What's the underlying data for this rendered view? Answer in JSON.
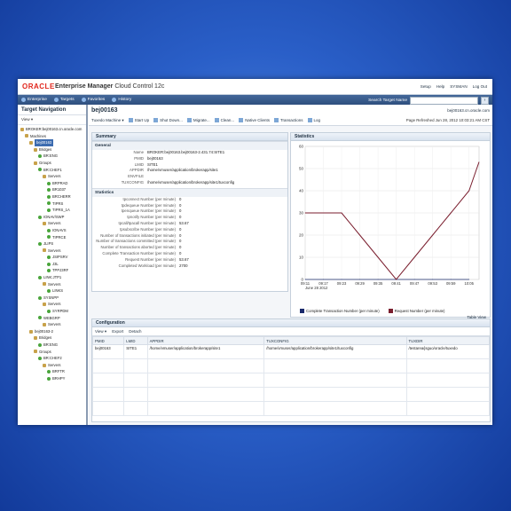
{
  "header": {
    "logo": "ORACLE",
    "product": "Enterprise Manager",
    "edition": "Cloud Control 12c",
    "links": [
      "Setup",
      "Help",
      "SYSMAN",
      "Log Out"
    ]
  },
  "menu": [
    "Enterprise",
    "Targets",
    "Favorites",
    "History"
  ],
  "search": {
    "label": "Search Target Name"
  },
  "nav": {
    "title": "Target Navigation",
    "view": "View ▾",
    "items": [
      "BROKER:bej00163.cn.oracle.com",
      "Machines",
      "bej00163",
      "Bridges",
      "BR:ENG",
      "Groups",
      "BR:CHEF1",
      "Servers",
      "BRPRAD",
      "BR1037",
      "BRCHERR",
      "TIPRS",
      "TIPRS_1A",
      "IONAV/SWP",
      "Servers",
      "IONAVS",
      "TIPRCE",
      "JLIPS",
      "Servers",
      "JSIPSRV",
      "J3L",
      "TPPJ3RF",
      "LINK:JTP1",
      "Servers",
      "LINKS",
      "SYSNPP",
      "Servers",
      "SYRPDM",
      "WEBGRP",
      "Servers",
      "bej00163-2",
      "Bridges",
      "BR:ENG",
      "Groups",
      "BR:CHEF2",
      "Servers",
      "BRFTR",
      "BRHPY"
    ]
  },
  "title": {
    "name": "bej00163",
    "domain": "bej00163.cn.oracle.com"
  },
  "actions": [
    "Tuxedo Machine ▾",
    "Start Up",
    "Shut Down...",
    "Migrate...",
    "Clean...",
    "Native Clients",
    "Transactions",
    "Log"
  ],
  "refresh": "Page Refreshed Jun 28, 2012 10:03:21 AM CST",
  "summary": {
    "title": "Summary",
    "general_label": "General",
    "general": [
      [
        "Name",
        "BROKER:bej00163.bej00163-2.431.74:SITE1"
      ],
      [
        "PMID",
        "bej00163"
      ],
      [
        "LMID",
        "SITE1"
      ],
      [
        "APPDIR",
        "/home/vmuser/application/brokerapp/site1"
      ],
      [
        "ENVFILE",
        ""
      ],
      [
        "TUXCONFIG",
        "/home/vmuser/application/brokerapp/site1/tuxconfig"
      ]
    ],
    "stats_label": "Statistics",
    "stats": [
      [
        "tpconnect Number (per minute)",
        "0"
      ],
      [
        "tpdequeue Number (per minute)",
        "0"
      ],
      [
        "tpenqueue Number (per minute)",
        "0"
      ],
      [
        "tpnotify Number (per minute)",
        "0"
      ],
      [
        "tpcall/tpacall Number (per minute)",
        "53.67"
      ],
      [
        "tpsubscribe Number (per minute)",
        "0"
      ],
      [
        "Number of transactions initiated (per minute)",
        "0"
      ],
      [
        "Number of transactions committed (per minute)",
        "0"
      ],
      [
        "Number of transactions aborted (per minute)",
        "0"
      ],
      [
        "Complete Transaction Number (per minute)",
        "0"
      ],
      [
        "Request Number (per minute)",
        "53.67"
      ],
      [
        "Completed Workload (per minute)",
        "2700"
      ]
    ]
  },
  "statistics": {
    "title": "Statistics",
    "table_view": "Table View"
  },
  "chart_data": {
    "type": "line",
    "x": [
      "09:11",
      "09:17",
      "09:23",
      "09:29",
      "09:35",
      "09:41",
      "09:47",
      "09:53",
      "09:59",
      "10:05"
    ],
    "xdate": "June 28 2012",
    "ylim": [
      0,
      60
    ],
    "yticks": [
      0,
      10,
      20,
      30,
      40,
      50,
      60
    ],
    "series": [
      {
        "name": "Complete Transaction Number (per minute)",
        "color": "#1a2a6c",
        "values": [
          0,
          0,
          0,
          0,
          0,
          0,
          0,
          0,
          0,
          0
        ]
      },
      {
        "name": "Request Number (per minute)",
        "color": "#7a1e2e",
        "values": [
          30,
          30,
          30,
          20,
          10,
          0,
          10,
          20,
          30,
          40
        ]
      }
    ],
    "extra_end": 53
  },
  "config": {
    "title": "Configuration",
    "toolbar": [
      "View ▾",
      "Export",
      "Detach"
    ],
    "columns": [
      "PMID",
      "LMID",
      "APPDIR",
      "TUXCONFIG",
      "TUXDIR"
    ],
    "rows": [
      [
        "bej00163",
        "SITE1",
        "/home/vmuser/application/brokerapp/site1",
        "/home/vmuser/application/brokerapp/site1/tuxconfig",
        "/testarea/jsguo/oracle/tuxedo"
      ]
    ]
  }
}
